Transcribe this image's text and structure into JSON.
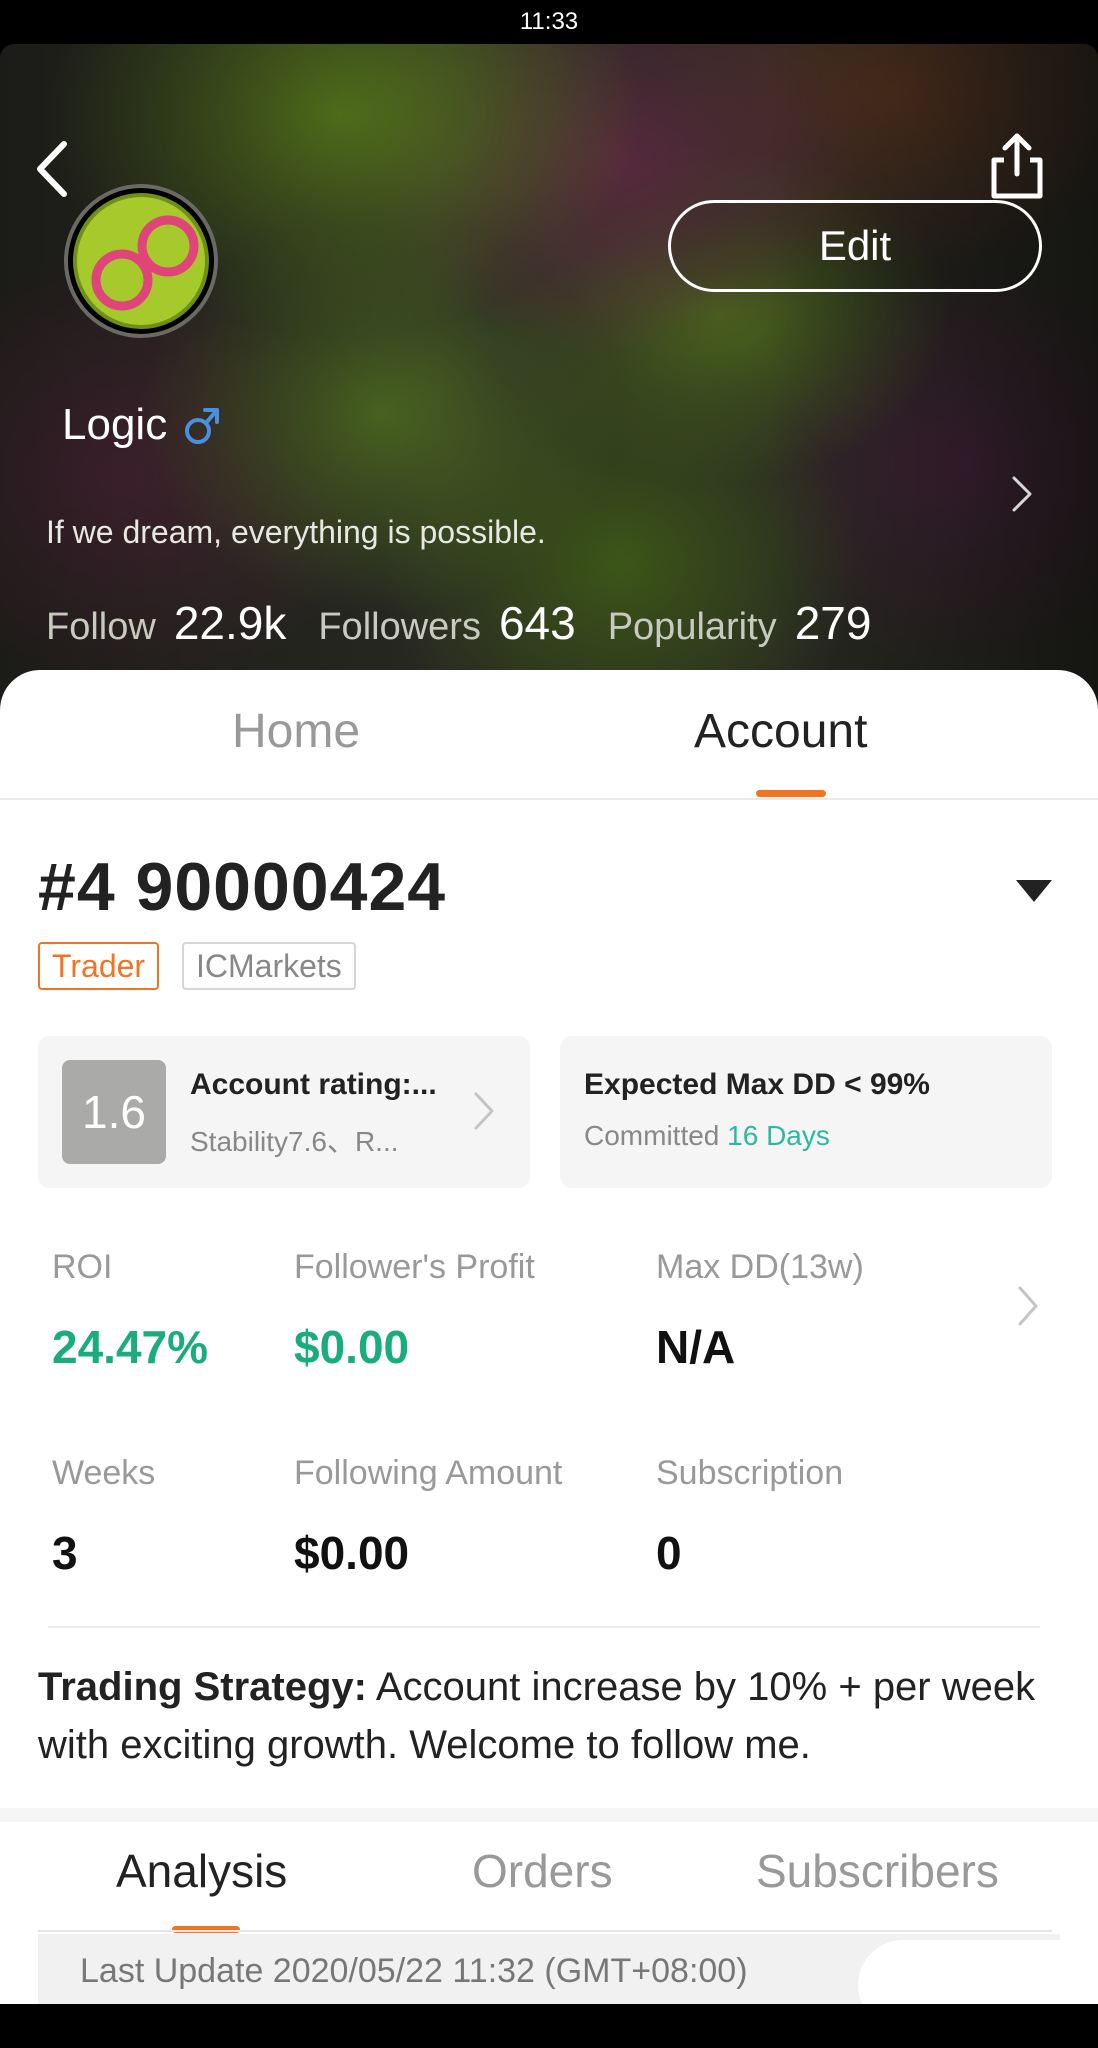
{
  "status_bar": {
    "time": "11:33"
  },
  "profile": {
    "username": "Logic",
    "gender_icon": "male-symbol-icon",
    "bio": "If we dream, everything is possible.",
    "edit_label": "Edit",
    "stats": [
      {
        "label": "Follow",
        "value": "22.9k"
      },
      {
        "label": "Followers",
        "value": "643"
      },
      {
        "label": "Popularity",
        "value": "279"
      }
    ]
  },
  "tabs": {
    "home": "Home",
    "account": "Account",
    "active": "Account"
  },
  "account": {
    "number": "#4 90000424",
    "tags": [
      "Trader",
      "ICMarkets"
    ],
    "rating_card": {
      "score": "1.6",
      "title": "Account rating:...",
      "subtitle": "Stability7.6、R..."
    },
    "dd_card": {
      "title": "Expected Max DD < 99%",
      "committed_label": "Committed",
      "committed_value": "16 Days"
    },
    "metrics": [
      {
        "label": "ROI",
        "value": "24.47%"
      },
      {
        "label": "Follower's Profit",
        "value": "$0.00"
      },
      {
        "label": "Max DD(13w)",
        "value": "N/A"
      },
      {
        "label": "Weeks",
        "value": "3"
      },
      {
        "label": "Following Amount",
        "value": "$0.00"
      },
      {
        "label": "Subscription",
        "value": "0"
      }
    ],
    "strategy": {
      "label": "Trading Strategy:",
      "text": "Account increase by 10% + per week with exciting growth. Welcome to follow me."
    }
  },
  "sub_tabs": {
    "analysis": "Analysis",
    "orders": "Orders",
    "subscribers": "Subscribers",
    "active": "Analysis"
  },
  "last_update": "Last Update 2020/05/22 11:32 (GMT+08:00)",
  "colors": {
    "accent": "#f07522",
    "positive": "#1bac7d",
    "teal": "#2bb9a0"
  }
}
